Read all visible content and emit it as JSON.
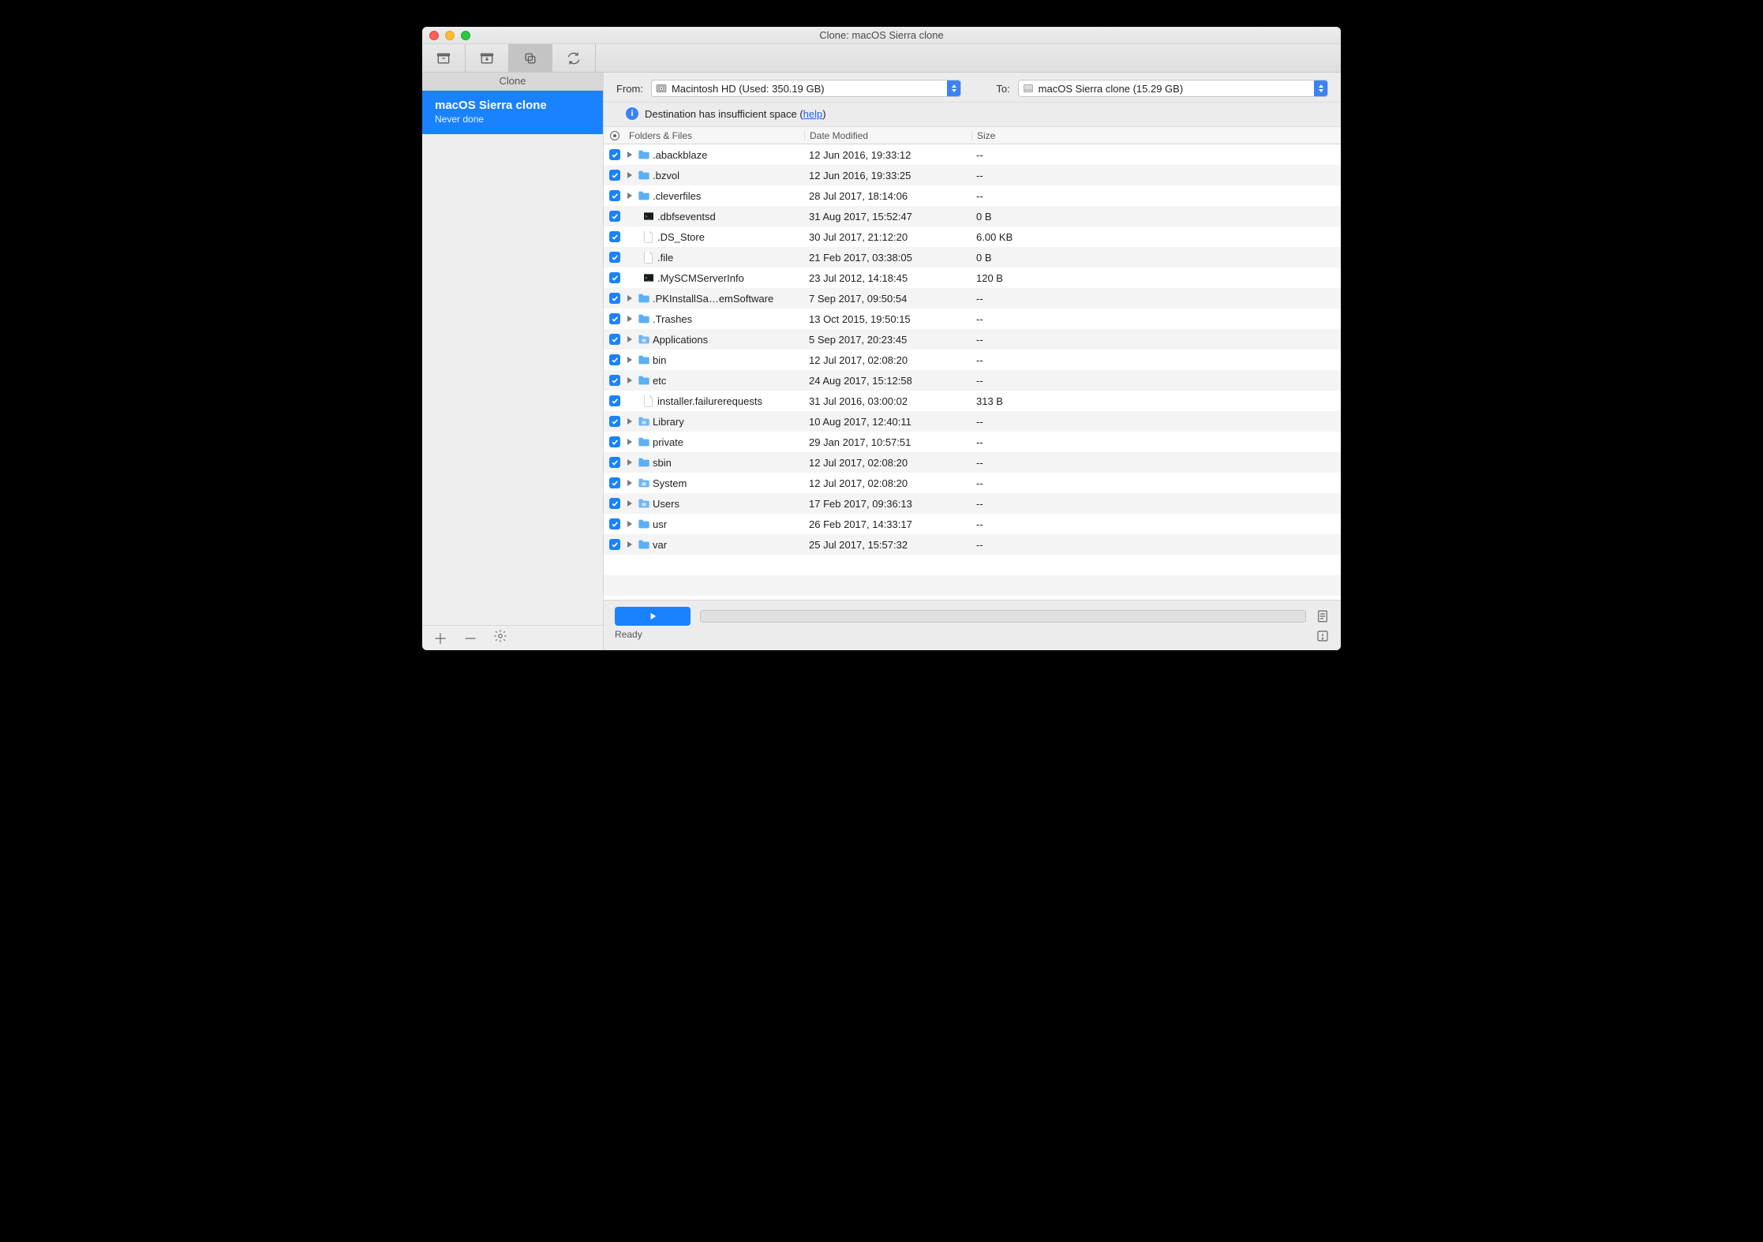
{
  "window": {
    "title": "Clone: macOS Sierra clone"
  },
  "sidebar": {
    "header": "Clone",
    "task": {
      "name": "macOS Sierra clone",
      "status": "Never done"
    }
  },
  "source": {
    "from_label": "From:",
    "from_value": "Macintosh HD (Used: 350.19 GB)",
    "to_label": "To:",
    "to_value": "macOS Sierra clone (15.29 GB)"
  },
  "warning": {
    "text_pre": "Destination has insufficient space (",
    "link": "help",
    "text_post": ")"
  },
  "columns": {
    "name": "Folders & Files",
    "date": "Date Modified",
    "size": "Size"
  },
  "rows": [
    {
      "chk": true,
      "exp": true,
      "icon": "folder",
      "name": ".abackblaze",
      "date": "12 Jun 2016, 19:33:12",
      "size": "--"
    },
    {
      "chk": true,
      "exp": true,
      "icon": "folder",
      "name": ".bzvol",
      "date": "12 Jun 2016, 19:33:25",
      "size": "--"
    },
    {
      "chk": true,
      "exp": true,
      "icon": "folder",
      "name": ".cleverfiles",
      "date": "28 Jul 2017, 18:14:06",
      "size": "--"
    },
    {
      "chk": true,
      "exp": false,
      "icon": "exec",
      "name": ".dbfseventsd",
      "date": "31 Aug 2017, 15:52:47",
      "size": "0 B"
    },
    {
      "chk": true,
      "exp": false,
      "icon": "file",
      "name": ".DS_Store",
      "date": "30 Jul 2017, 21:12:20",
      "size": "6.00 KB"
    },
    {
      "chk": true,
      "exp": false,
      "icon": "file",
      "name": ".file",
      "date": "21 Feb 2017, 03:38:05",
      "size": "0 B"
    },
    {
      "chk": true,
      "exp": false,
      "icon": "exec",
      "name": ".MySCMServerInfo",
      "date": "23 Jul 2012, 14:18:45",
      "size": "120 B"
    },
    {
      "chk": true,
      "exp": true,
      "icon": "folder",
      "name": ".PKInstallSa…emSoftware",
      "date": "7 Sep 2017, 09:50:54",
      "size": "--"
    },
    {
      "chk": true,
      "exp": true,
      "icon": "folder",
      "name": ".Trashes",
      "date": "13 Oct 2015, 19:50:15",
      "size": "--"
    },
    {
      "chk": true,
      "exp": true,
      "icon": "folder-sys",
      "name": "Applications",
      "date": "5 Sep 2017, 20:23:45",
      "size": "--"
    },
    {
      "chk": true,
      "exp": true,
      "icon": "folder",
      "name": "bin",
      "date": "12 Jul 2017, 02:08:20",
      "size": "--"
    },
    {
      "chk": true,
      "exp": true,
      "icon": "folder",
      "name": "etc",
      "date": "24 Aug 2017, 15:12:58",
      "size": "--"
    },
    {
      "chk": true,
      "exp": false,
      "icon": "file",
      "name": "installer.failurerequests",
      "date": "31 Jul 2016, 03:00:02",
      "size": "313 B"
    },
    {
      "chk": true,
      "exp": true,
      "icon": "folder-sys",
      "name": "Library",
      "date": "10 Aug 2017, 12:40:11",
      "size": "--"
    },
    {
      "chk": true,
      "exp": true,
      "icon": "folder",
      "name": "private",
      "date": "29 Jan 2017, 10:57:51",
      "size": "--"
    },
    {
      "chk": true,
      "exp": true,
      "icon": "folder",
      "name": "sbin",
      "date": "12 Jul 2017, 02:08:20",
      "size": "--"
    },
    {
      "chk": true,
      "exp": true,
      "icon": "folder-sys",
      "name": "System",
      "date": "12 Jul 2017, 02:08:20",
      "size": "--"
    },
    {
      "chk": true,
      "exp": true,
      "icon": "folder-sys",
      "name": "Users",
      "date": "17 Feb 2017, 09:36:13",
      "size": "--"
    },
    {
      "chk": true,
      "exp": true,
      "icon": "folder",
      "name": "usr",
      "date": "26 Feb 2017, 14:33:17",
      "size": "--"
    },
    {
      "chk": true,
      "exp": true,
      "icon": "folder",
      "name": "var",
      "date": "25 Jul 2017, 15:57:32",
      "size": "--"
    }
  ],
  "footer": {
    "status": "Ready"
  }
}
